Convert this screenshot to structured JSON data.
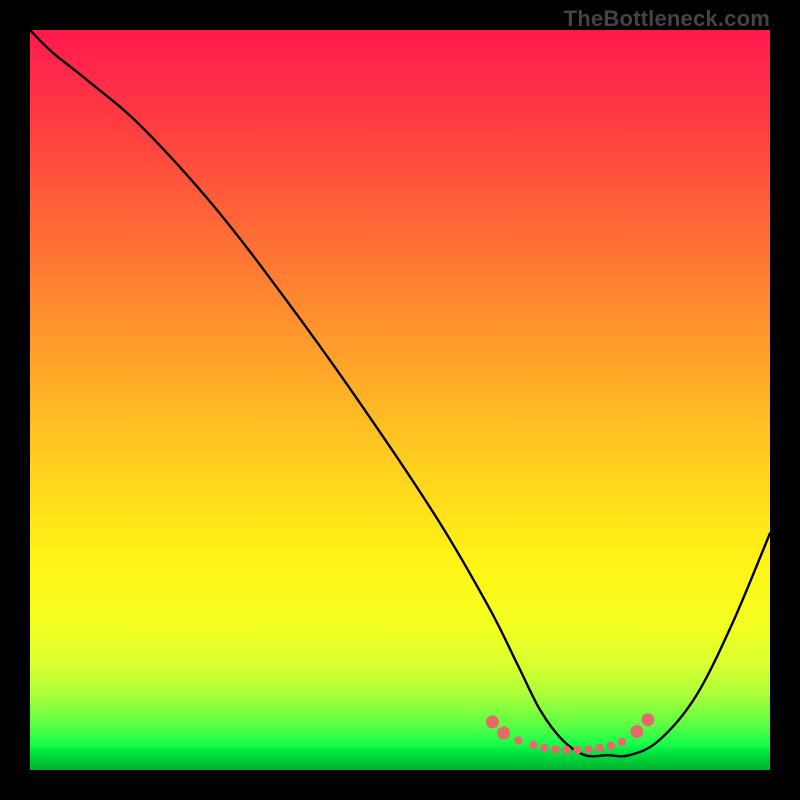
{
  "watermark": "TheBottleneck.com",
  "chart_data": {
    "type": "line",
    "title": "",
    "xlabel": "",
    "ylabel": "",
    "xlim": [
      0,
      100
    ],
    "ylim": [
      0,
      100
    ],
    "series": [
      {
        "name": "bottleneck-curve",
        "x": [
          0,
          3,
          8,
          15,
          25,
          35,
          45,
          55,
          62,
          66,
          69,
          72,
          75,
          78,
          81,
          85,
          90,
          95,
          100
        ],
        "y": [
          100,
          97,
          93,
          87,
          76,
          63,
          49,
          34,
          22,
          14,
          8,
          4,
          2,
          2,
          2,
          4,
          10,
          20,
          32
        ]
      }
    ],
    "flat_region_markers": {
      "comment": "small salmon dots near the valley bottom",
      "x": [
        62.5,
        64,
        66,
        68,
        69.5,
        71,
        72.5,
        74,
        75.5,
        77,
        78.5,
        80,
        82,
        83.5
      ],
      "y": [
        6.5,
        5.0,
        4.0,
        3.4,
        3.0,
        2.8,
        2.7,
        2.7,
        2.8,
        3.0,
        3.3,
        3.8,
        5.2,
        6.8
      ]
    },
    "colors": {
      "curve": "#000000",
      "marker": "#e76a6a",
      "gradient_top": "#ff1a4d",
      "gradient_mid": "#fff415",
      "gradient_bottom": "#00b030",
      "frame": "#000000"
    }
  }
}
